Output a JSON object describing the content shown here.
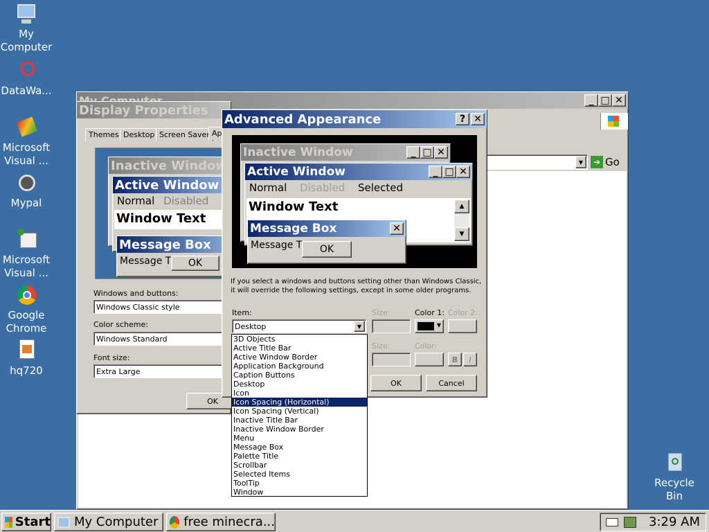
{
  "desktop": {
    "icons": [
      {
        "label": "My Computer",
        "icon": "my-computer-icon"
      },
      {
        "label": "DataWa...",
        "icon": "datawave-icon"
      },
      {
        "label": "Microsoft Visual ...",
        "icon": "visual-studio-icon"
      },
      {
        "label": "Mypal",
        "icon": "mypal-icon"
      },
      {
        "label": "Microsoft Visual ...",
        "icon": "visual-studio-icon"
      },
      {
        "label": "Google Chrome",
        "icon": "chrome-icon"
      },
      {
        "label": "hq720",
        "icon": "image-file-icon"
      },
      {
        "label": "Recycle Bin",
        "icon": "recycle-bin-icon"
      }
    ]
  },
  "explorer": {
    "title": "My Computer",
    "go_label": "Go"
  },
  "display_properties": {
    "title": "Display Properties",
    "tabs": [
      "Themes",
      "Desktop",
      "Screen Saver",
      "Ap"
    ],
    "preview": {
      "inactive": "Inactive Window",
      "active": "Active Window",
      "normal": "Normal",
      "disabled": "Disabled",
      "window_text": "Window Text",
      "message_box": "Message Box",
      "message_text": "Message T",
      "ok": "OK"
    },
    "windows_buttons_label": "Windows and buttons:",
    "windows_buttons_value": "Windows Classic style",
    "color_scheme_label": "Color scheme:",
    "color_scheme_value": "Windows Standard",
    "font_size_label": "Font size:",
    "font_size_value": "Extra Large",
    "ok": "OK"
  },
  "advanced": {
    "title": "Advanced Appearance",
    "help": "?",
    "preview": {
      "inactive": "Inactive Window",
      "active": "Active Window",
      "normal": "Normal",
      "disabled": "Disabled",
      "selected": "Selected",
      "window_text": "Window Text",
      "message_box": "Message Box",
      "message_text": "Message T",
      "ok": "OK"
    },
    "info_line1": "If you select a windows and buttons setting other than Windows Classic,",
    "info_line2": "it will override the following settings, except in some older programs.",
    "item_label": "Item:",
    "item_value": "Desktop",
    "size_label": "Size:",
    "color1_label": "Color 1:",
    "color2_label": "Color 2:",
    "font_size_label": "Size:",
    "font_color_label": "Color:",
    "bold": "B",
    "italic": "I",
    "ok": "OK",
    "cancel": "Cancel",
    "dropdown_items": [
      "3D Objects",
      "Active Title Bar",
      "Active Window Border",
      "Application Background",
      "Caption Buttons",
      "Desktop",
      "Icon",
      "Icon Spacing (Horizontal)",
      "Icon Spacing (Vertical)",
      "Inactive Title Bar",
      "Inactive Window Border",
      "Menu",
      "Message Box",
      "Palette Title",
      "Scrollbar",
      "Selected Items",
      "ToolTip",
      "Window"
    ],
    "selected_index": 7
  },
  "taskbar": {
    "start": "Start",
    "tasks": [
      {
        "label": "My Computer"
      },
      {
        "label": "free minecra..."
      }
    ],
    "clock": "3:29 AM"
  },
  "colors": {
    "desktop": "#3a6ea5",
    "title_active": "#0a246a",
    "face": "#d4d0c8"
  }
}
